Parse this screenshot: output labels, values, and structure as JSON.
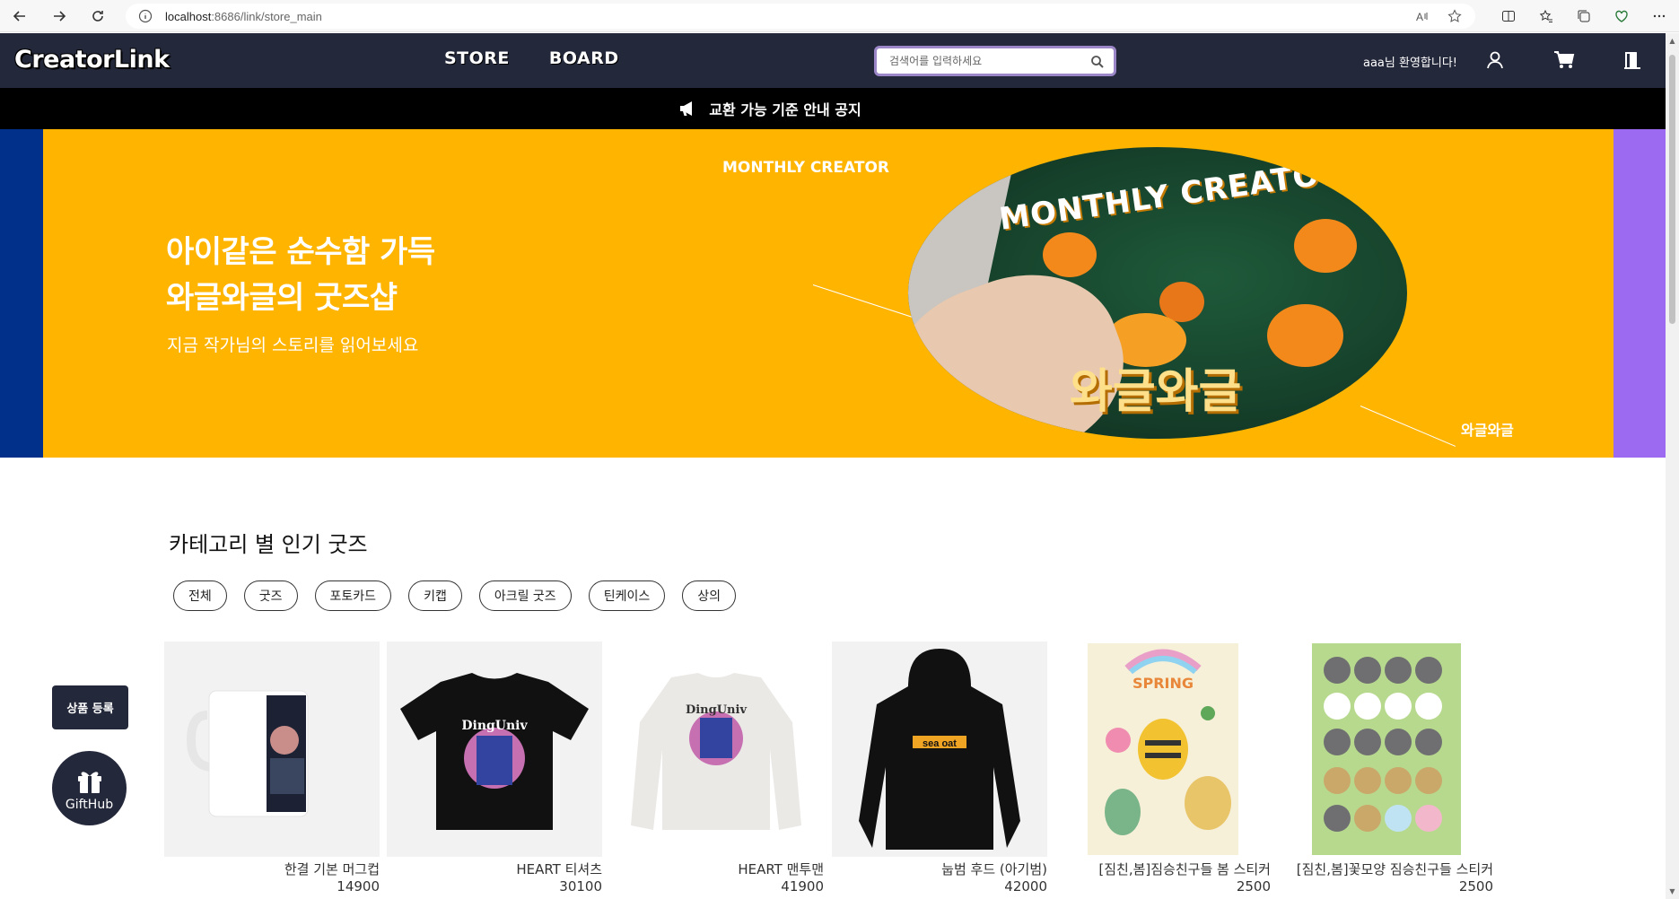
{
  "browser": {
    "url_host": "localhost",
    "url_path": ":8686/link/store_main"
  },
  "header": {
    "logo": "CreatorLink",
    "nav": [
      "STORE",
      "BOARD"
    ],
    "search_placeholder": "검색어를 입력하세요",
    "welcome": "aaa님 환영합니다!"
  },
  "notice": {
    "text": "교환 가능 기준 안내 공지"
  },
  "banner": {
    "title_line1": "아이같은 순수함 가득",
    "title_line2": "와글와글의 굿즈샵",
    "subtitle": "지금 작가님의 스토리를 읽어보세요",
    "tag_top": "MONTHLY CREATOR",
    "tag_bottom": "와글와글",
    "image_title": "MONTHLY CREATOR",
    "image_name": "와글와글",
    "colors": {
      "background": "#ffb400",
      "left_strip": "#00308a",
      "right_strip": "#9b6af0"
    }
  },
  "category_section": {
    "title": "카테고리 별 인기 굿즈",
    "chips": [
      "전체",
      "굿즈",
      "포토카드",
      "키캡",
      "아크릴 굿즈",
      "틴케이스",
      "상의"
    ]
  },
  "products": [
    {
      "name": "한결 기본 머그컵",
      "price": "14900"
    },
    {
      "name": "HEART 티셔츠",
      "price": "30100"
    },
    {
      "name": "HEART 맨투맨",
      "price": "41900"
    },
    {
      "name": "눕범 후드 (아기범)",
      "price": "42000"
    },
    {
      "name": "[짐친,봄]짐승친구들 봄 스티커",
      "price": "2500"
    },
    {
      "name": "[짐친,봄]꽃모양 짐승친구들 스티커",
      "price": "2500"
    }
  ],
  "floating": {
    "register_label": "상품 등록",
    "gift_label": "GiftHub"
  },
  "theme": {
    "header_bg": "#24283b",
    "notice_bg": "#000000"
  }
}
